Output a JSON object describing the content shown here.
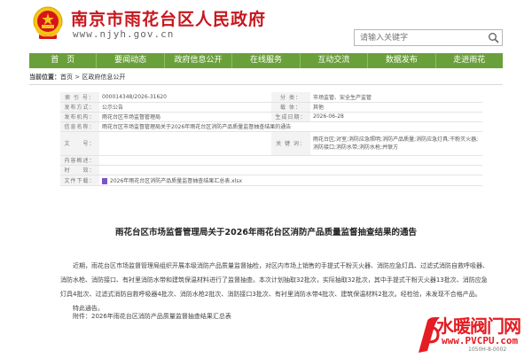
{
  "header": {
    "site_title": "南京市雨花台区人民政府",
    "site_url": "www.njyh.gov.cn",
    "search_placeholder": "请输入关键字"
  },
  "nav": {
    "items": [
      "首　页",
      "要闻动态",
      "政府信息公开",
      "在线服务",
      "互动交流",
      "数据发布",
      "走进雨花"
    ]
  },
  "breadcrumb": {
    "label": "当前位置：",
    "items": [
      "首页",
      "区政府信息公开"
    ],
    "separator": " > "
  },
  "info": {
    "index_label": "索 引 号：",
    "index_value": "000014348/2026-31620",
    "category_label": "分 类：",
    "category_value": "市场监管、安全生产监管",
    "method_label": "发布方式：",
    "method_value": "公示公告",
    "carrier_label": "载 体：",
    "carrier_value": "其他",
    "org_label": "发布机构：",
    "org_value": "雨花台区市场监督管理局",
    "date_label": "生成日期：",
    "date_value": "2026-06-28",
    "name_label": "信息名称：",
    "name_value": "雨花台区市场监督管理局关于2026年雨花台区消防产品质量监督抽查结果的通告",
    "docno_label": "文　　号：",
    "docno_value": "",
    "keywords_label": "关 键 词：",
    "keywords_value": "雨花台区;对室;消防应急照明;消防产品质量;消防应急灯具;干粉灭火器;消防接口;消防水带;消防水枪;并联方",
    "summary_label": "内容概述：",
    "summary_value": "",
    "period_label": "时　　效：",
    "period_value": "",
    "attach_label": "文件下载：",
    "attach_value": "2026年雨花台区消防产品质量监督抽查结果汇总表.xlsx"
  },
  "article": {
    "title": "雨花台区市场监督管理局关于2026年雨花台区消防产品质量监督抽查结果的通告",
    "paragraph1": "近期，雨花台区市场监督管理局组织开展本级消防产品质量监督抽检，对区内市场上销售的手提式干粉灭火器、消防应急灯具、过滤式消防自救呼吸器、消防水枪、消防接口、有衬里消防水带和建筑保温材料进行了监督抽查。本次计划抽取32批次，实际抽取32批次，其中手提式干粉灭火器13批次、消防应急灯具4批次、过滤式消防自救呼吸器4批次、消防水枪2批次、消防接口3批次、有衬里消防水带4批次、建筑保温材料2批次。经检验，未发现不合格产品。",
    "paragraph2": "特此通告。",
    "attachment": "附件：2026年雨花台区消防产品质量监督抽查结果汇总表"
  },
  "watermark": {
    "text": "水暖阀门网",
    "url": "www.PVCPU.com",
    "tag": "1050H-8-0002"
  },
  "colors": {
    "title_red": "#c8161d",
    "nav_green": "#6aa03a",
    "watermark_red": "#e51c23"
  }
}
